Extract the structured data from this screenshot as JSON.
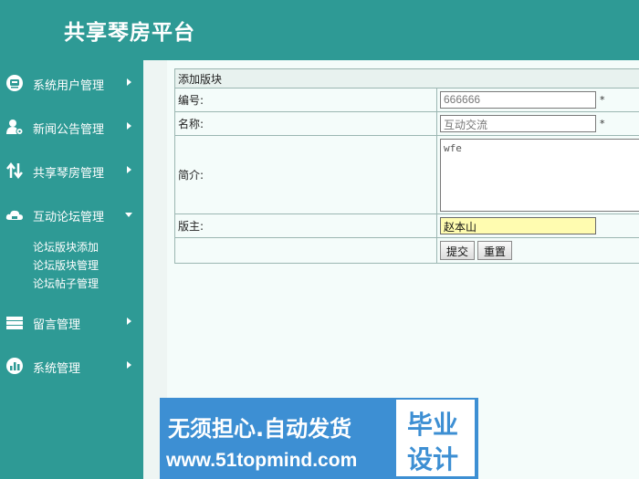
{
  "header": {
    "title": "共享琴房平台"
  },
  "sidebar": {
    "items": [
      {
        "label": "系统用户管理",
        "icon": "user-card-icon"
      },
      {
        "label": "新闻公告管理",
        "icon": "user-gear-icon"
      },
      {
        "label": "共享琴房管理",
        "icon": "swap-arrows-icon"
      },
      {
        "label": "互动论坛管理",
        "icon": "cloud-icon",
        "expanded": true,
        "submenu": [
          "论坛版块添加",
          "论坛版块管理",
          "论坛帖子管理"
        ]
      },
      {
        "label": "留言管理",
        "icon": "stack-icon"
      },
      {
        "label": "系统管理",
        "icon": "chart-icon"
      }
    ]
  },
  "form": {
    "title": "添加版块",
    "fields": {
      "code_label": "编号:",
      "code_value": "666666",
      "name_label": "名称:",
      "name_value": "互动交流",
      "intro_label": "简介:",
      "intro_value": "wfe",
      "moderator_label": "版主:",
      "moderator_value": "赵本山",
      "required_mark": "*"
    },
    "buttons": {
      "submit": "提交",
      "reset": "重置"
    }
  },
  "banner": {
    "line1": "无须担心.自动发货",
    "line2": "www.51topmind.com",
    "tag_line1": "毕业",
    "tag_line2": "设计"
  }
}
